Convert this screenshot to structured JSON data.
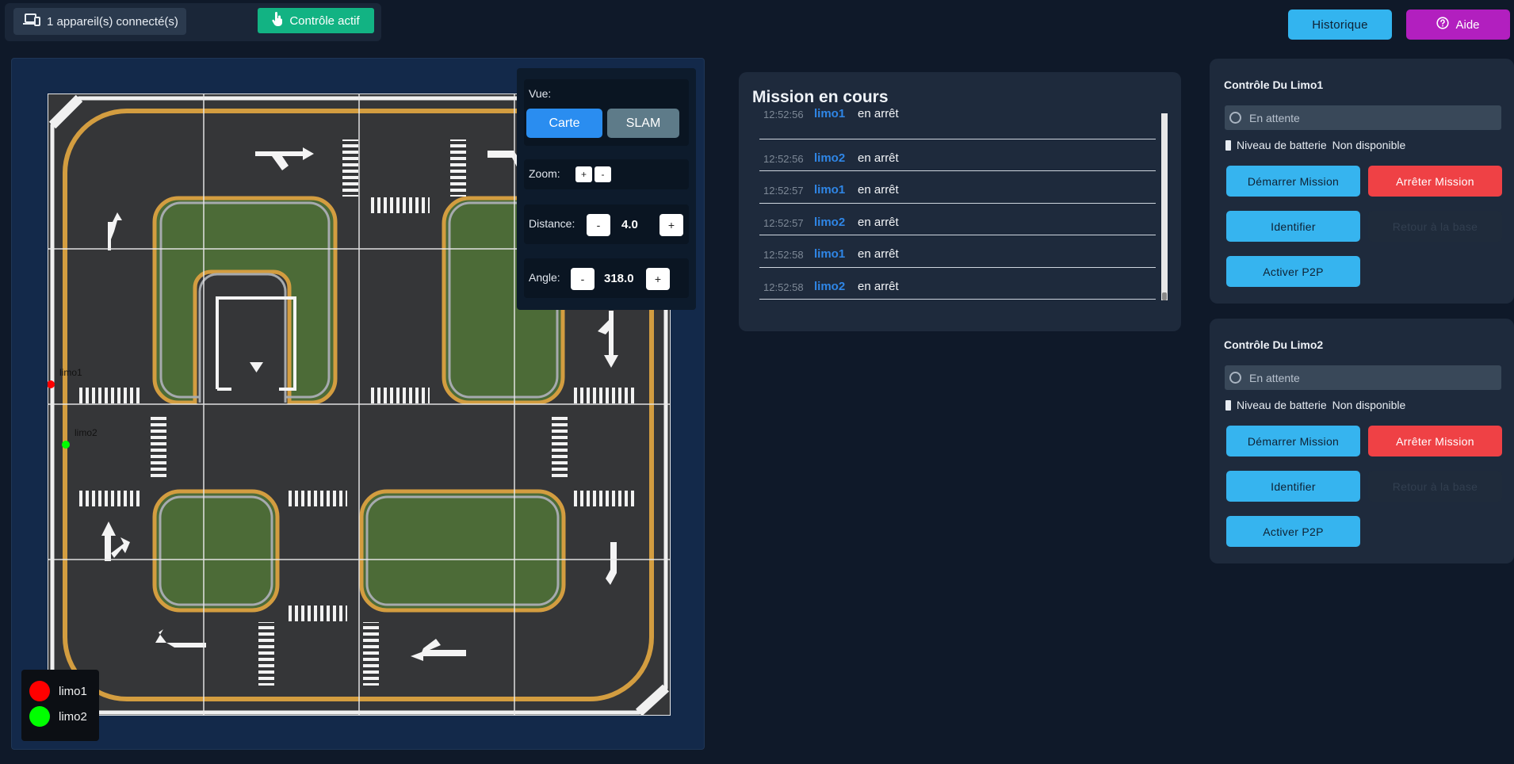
{
  "topbar": {
    "devices_label": "1 appareil(s) connecté(s)",
    "control_label": "Contrôle actif",
    "history_label": "Historique",
    "help_label": "Aide"
  },
  "map": {
    "legend": [
      {
        "name": "limo1",
        "color": "#ff0000"
      },
      {
        "name": "limo2",
        "color": "#00ff00"
      }
    ],
    "robot_labels": {
      "limo1": "limo1",
      "limo2": "limo2"
    },
    "view": {
      "view_label": "Vue:",
      "carte_label": "Carte",
      "slam_label": "SLAM",
      "zoom_label": "Zoom:",
      "zoom_in": "+",
      "zoom_out": "-",
      "distance_label": "Distance:",
      "distance_value": "4.0",
      "angle_label": "Angle:",
      "angle_value": "318.0",
      "minus": "-",
      "plus": "+"
    }
  },
  "mission": {
    "title": "Mission en cours",
    "log": [
      {
        "time": "12:52:56",
        "device": "limo1",
        "status": "en arrêt"
      },
      {
        "time": "12:52:56",
        "device": "limo2",
        "status": "en arrêt"
      },
      {
        "time": "12:52:57",
        "device": "limo1",
        "status": "en arrêt"
      },
      {
        "time": "12:52:57",
        "device": "limo2",
        "status": "en arrêt"
      },
      {
        "time": "12:52:58",
        "device": "limo1",
        "status": "en arrêt"
      },
      {
        "time": "12:52:58",
        "device": "limo2",
        "status": "en arrêt"
      }
    ]
  },
  "limos": [
    {
      "title": "Contrôle Du Limo1",
      "status": "En attente",
      "battery_label": "Niveau de batterie",
      "battery_value": "Non disponible",
      "start": "Démarrer Mission",
      "stop": "Arrêter Mission",
      "identify": "Identifier",
      "return_base": "Retour à la base",
      "p2p": "Activer P2P"
    },
    {
      "title": "Contrôle Du Limo2",
      "status": "En attente",
      "battery_label": "Niveau de batterie",
      "battery_value": "Non disponible",
      "start": "Démarrer Mission",
      "stop": "Arrêter Mission",
      "identify": "Identifier",
      "return_base": "Retour à la base",
      "p2p": "Activer P2P"
    }
  ]
}
